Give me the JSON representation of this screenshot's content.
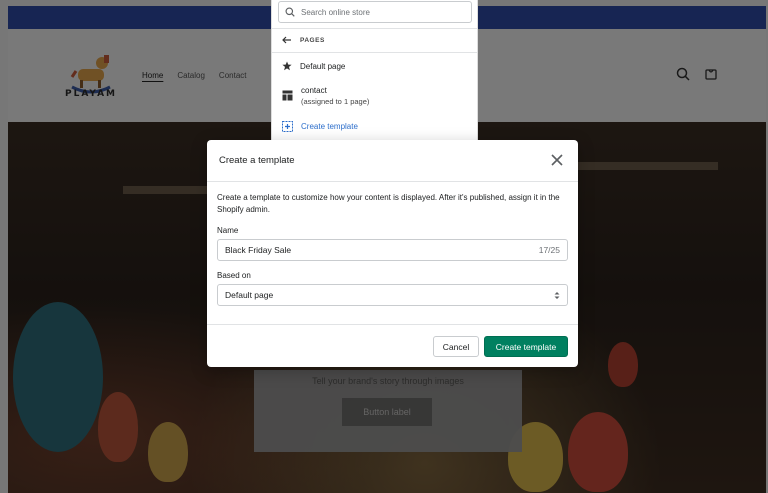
{
  "store": {
    "logo_text": "PLAYAM",
    "nav": [
      "Home",
      "Catalog",
      "Contact"
    ],
    "hero_text": "Tell your brand's story through images",
    "hero_button": "Button label"
  },
  "picker": {
    "search_placeholder": "Search online store",
    "section": "PAGES",
    "items": [
      {
        "label": "Default page",
        "icon": "star-icon"
      },
      {
        "label": "contact",
        "sub": "(assigned to 1 page)",
        "icon": "layout-icon"
      },
      {
        "label": "Create template",
        "icon": "add-template-icon"
      }
    ]
  },
  "modal": {
    "title": "Create a template",
    "description": "Create a template to customize how your content is displayed. After it's published, assign it in the Shopify admin.",
    "name_label": "Name",
    "name_value": "Black Friday Sale",
    "name_counter": "17/25",
    "based_on_label": "Based on",
    "based_on_value": "Default page",
    "cancel_label": "Cancel",
    "create_label": "Create template"
  },
  "colors": {
    "announce_bar": "#2f4aa6",
    "primary": "#008060",
    "link": "#2c6ecb"
  }
}
